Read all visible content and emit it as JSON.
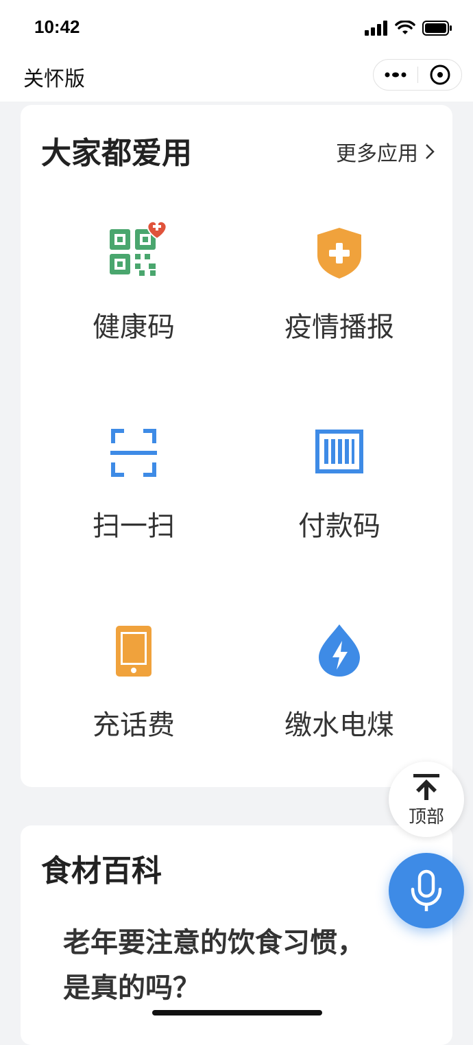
{
  "status_bar": {
    "time": "10:42"
  },
  "nav": {
    "title": "关怀版",
    "more_icon": "more-dots-icon",
    "close_icon": "close-circle-icon"
  },
  "apps_card": {
    "title": "大家都爱用",
    "more_link": "更多应用",
    "items": [
      {
        "label": "健康码",
        "icon": "health-qr-code-icon",
        "color": "#4aa66e",
        "badge_color": "#e0533b"
      },
      {
        "label": "疫情播报",
        "icon": "shield-plus-icon",
        "color": "#f0a23c"
      },
      {
        "label": "扫一扫",
        "icon": "scan-icon",
        "color": "#3e8be6"
      },
      {
        "label": "付款码",
        "icon": "barcode-icon",
        "color": "#3e8be6"
      },
      {
        "label": "充话费",
        "icon": "phone-icon",
        "color": "#f0a23c"
      },
      {
        "label": "缴水电煤",
        "icon": "water-bolt-icon",
        "color": "#3e8be6"
      }
    ]
  },
  "float": {
    "top_label": "顶部",
    "top_icon": "arrow-up-to-top-icon",
    "mic_icon": "microphone-icon",
    "mic_color": "#3e8be6"
  },
  "food_card": {
    "title": "食材百科",
    "article_line1": "老年要注意的饮食习惯，",
    "article_line2": "是真的吗？"
  }
}
